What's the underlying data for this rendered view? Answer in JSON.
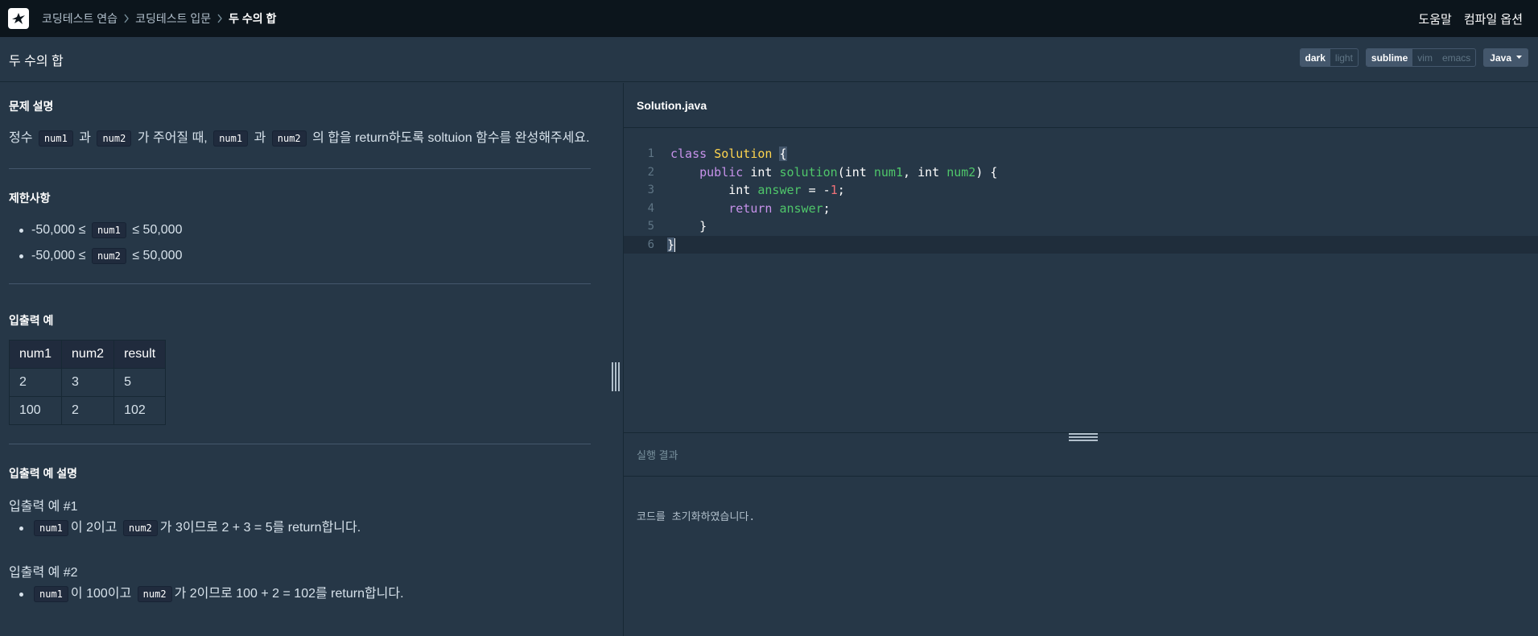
{
  "nav": {
    "breadcrumbs": [
      "코딩테스트 연습",
      "코딩테스트 입문",
      "두 수의 합"
    ],
    "help": "도움말",
    "compile_options": "컴파일 옵션"
  },
  "header": {
    "title": "두 수의 합",
    "theme": {
      "dark": "dark",
      "light": "light",
      "selected": "dark"
    },
    "keymap": {
      "sublime": "sublime",
      "vim": "vim",
      "emacs": "emacs",
      "selected": "sublime"
    },
    "language": "Java"
  },
  "problem": {
    "desc_heading": "문제 설명",
    "desc": {
      "p1": "정수",
      "c1": "num1",
      "p2": "과",
      "c2": "num2",
      "p3": "가 주어질 때,",
      "c3": "num1",
      "p4": "과",
      "c4": "num2",
      "p5": "의 합을 return하도록 soltuion 함수를 완성해주세요."
    },
    "constraints_heading": "제한사항",
    "constraints": [
      {
        "pre": "-50,000 ≤",
        "code": "num1",
        "post": "≤ 50,000"
      },
      {
        "pre": "-50,000 ≤",
        "code": "num2",
        "post": "≤ 50,000"
      }
    ],
    "io_heading": "입출력 예",
    "io_table": {
      "headers": [
        "num1",
        "num2",
        "result"
      ],
      "rows": [
        [
          "2",
          "3",
          "5"
        ],
        [
          "100",
          "2",
          "102"
        ]
      ]
    },
    "io_desc_heading": "입출력 예 설명",
    "examples": [
      {
        "title": "입출력 예 #1",
        "c1": "num1",
        "t1": "이 2이고",
        "c2": "num2",
        "t2": "가 3이므로 2 + 3 = 5를 return합니다."
      },
      {
        "title": "입출력 예 #2",
        "c1": "num1",
        "t1": "이 100이고",
        "c2": "num2",
        "t2": "가 2이므로 100 + 2 = 102를 return합니다."
      }
    ]
  },
  "editor": {
    "filename": "Solution.java",
    "line_numbers": [
      "1",
      "2",
      "3",
      "4",
      "5",
      "6"
    ],
    "code": {
      "l1": {
        "kw": "class",
        "cls": "Solution",
        "brace": "{"
      },
      "l2": {
        "kw": "public",
        "ty": "int",
        "fn": "solution",
        "open": "(",
        "t1": "int",
        "v1": "num1",
        "comma": ",",
        "t2": "int",
        "v2": "num2",
        "close": ") {"
      },
      "l3": {
        "ty": "int",
        "var": "answer",
        "eq": "= -",
        "num": "1",
        "semi": ";"
      },
      "l4": {
        "kw": "return",
        "var": "answer",
        "semi": ";"
      },
      "l5": {
        "brace": "}"
      },
      "l6": {
        "brace": "}"
      }
    }
  },
  "result": {
    "title": "실행 결과",
    "message": "코드를 초기화하였습니다."
  }
}
